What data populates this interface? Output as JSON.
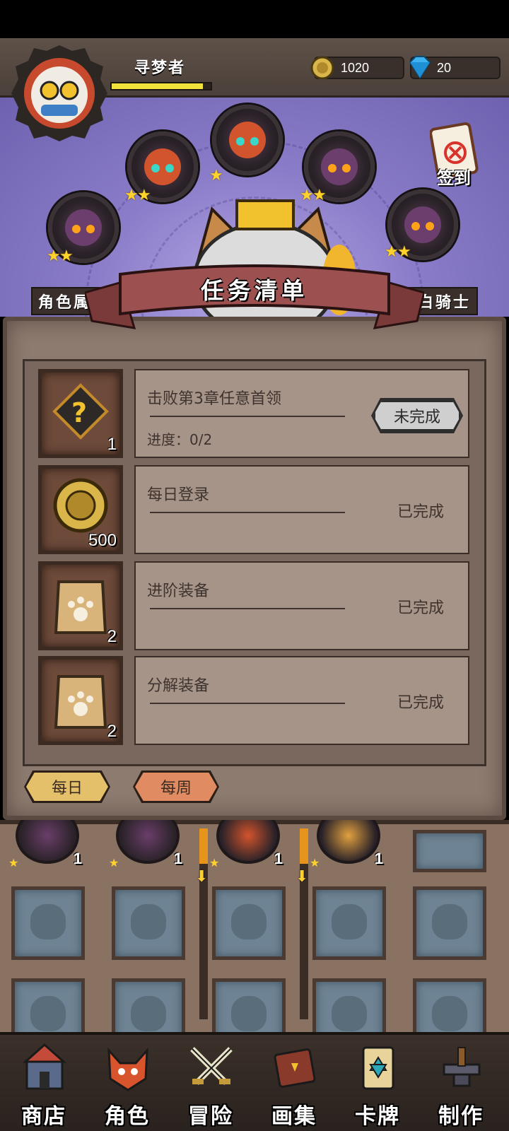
{
  "header": {
    "player_name": "寻梦者",
    "xp_fraction": 0.92,
    "coins": "1020",
    "gems": "20"
  },
  "stage": {
    "signin_label": "签到",
    "left_tab": "角色属性",
    "right_tab": "银白骑士",
    "nodes": [
      {
        "stars": 2
      },
      {
        "stars": 2
      },
      {
        "stars": 1
      },
      {
        "stars": 2
      },
      {
        "stars": 2
      }
    ]
  },
  "panel": {
    "title": "任务清单",
    "tasks": [
      {
        "title": "击败第3章任意首领",
        "progress": "进度：0/2",
        "status": "未完成",
        "reward_count": "1",
        "icon": "mystery-item-icon"
      },
      {
        "title": "每日登录",
        "progress": "",
        "status": "已完成",
        "reward_count": "500",
        "icon": "gold-coin-icon"
      },
      {
        "title": "进阶装备",
        "progress": "",
        "status": "已完成",
        "reward_count": "2",
        "icon": "paw-bag-icon"
      },
      {
        "title": "分解装备",
        "progress": "",
        "status": "已完成",
        "reward_count": "2",
        "icon": "paw-bag-icon"
      }
    ],
    "tabs": {
      "daily": "每日",
      "weekly": "每周"
    }
  },
  "inventory": {
    "hero_counts": [
      "1",
      "1",
      "1",
      "1"
    ]
  },
  "nav": {
    "shop": "商店",
    "character": "角色",
    "adventure": "冒险",
    "gallery": "画集",
    "cards": "卡牌",
    "craft": "制作"
  },
  "colors": {
    "accent_gold": "#f2e23c",
    "panel_brown": "#8d7b70",
    "stage_purple": "#8a7cc8",
    "ribbon_red": "#8a4a4a"
  }
}
